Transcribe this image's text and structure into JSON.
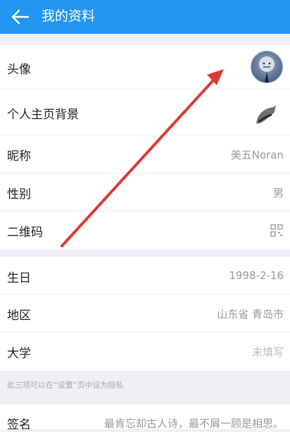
{
  "header": {
    "title": "我的资料",
    "back_icon": "back-arrow-icon"
  },
  "profile": {
    "avatar_label": "头像",
    "background_label": "个人主页背景",
    "nickname_label": "昵称",
    "nickname_value": "美五Noran",
    "gender_label": "性别",
    "gender_value": "男",
    "qrcode_label": "二维码",
    "qrcode_icon": "qr-code-icon"
  },
  "details": {
    "birthday_label": "生日",
    "birthday_value": "1998-2-16",
    "region_label": "地区",
    "region_value": "山东省 青岛市",
    "university_label": "大学",
    "university_value": "未填写",
    "privacy_note": "此三项可以在“设置”页中设为隐私"
  },
  "signature": {
    "label": "签名",
    "value": "最肯忘却古人诗，最不屑一顾是相思。"
  },
  "colors": {
    "accent": "#2196f3",
    "annotation_arrow": "#dc3a35"
  }
}
